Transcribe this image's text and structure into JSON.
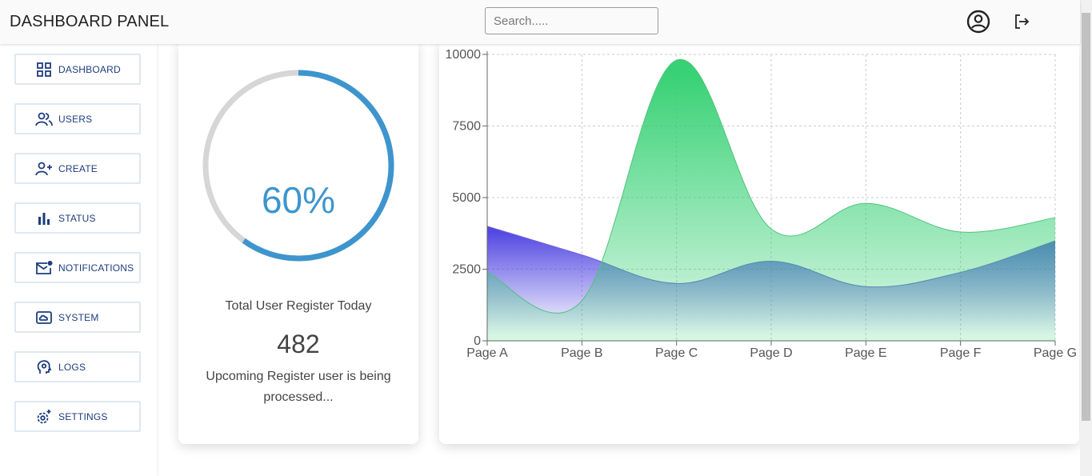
{
  "header": {
    "brand": "DASHBOARD PANEL",
    "search_placeholder": "Search.....",
    "profile_icon": "user-circle-icon",
    "logout_icon": "logout-icon"
  },
  "sidebar": {
    "items": [
      {
        "label": "DASHBOARD",
        "icon": "grid-icon"
      },
      {
        "label": "USERS",
        "icon": "users-icon"
      },
      {
        "label": "CREATE",
        "icon": "user-add-icon"
      },
      {
        "label": "STATUS",
        "icon": "bar-chart-icon"
      },
      {
        "label": "NOTIFICATIONS",
        "icon": "mail-badge-icon"
      },
      {
        "label": "SYSTEM",
        "icon": "cloud-box-icon"
      },
      {
        "label": "LOGS",
        "icon": "brain-icon"
      },
      {
        "label": "SETTINGS",
        "icon": "gear-icon"
      }
    ]
  },
  "progress_card": {
    "percent_text": "60%",
    "progress": 0.6,
    "title": "Total User Register Today",
    "count": "482",
    "note": "Upcoming Register user is being processed..."
  },
  "colors": {
    "accent": "#3e95cd",
    "sidebar_text": "#1d3d7e",
    "series_green": "#3ddc84",
    "series_blue": "#5b4fe0"
  },
  "chart_data": {
    "type": "area",
    "categories": [
      "Page A",
      "Page B",
      "Page C",
      "Page D",
      "Page E",
      "Page F",
      "Page G"
    ],
    "series": [
      {
        "values": [
          4000,
          3000,
          2000,
          2780,
          1890,
          2390,
          3490
        ]
      },
      {
        "values": [
          2400,
          1398,
          9800,
          3908,
          4800,
          3800,
          4300
        ]
      }
    ],
    "yticks": [
      0,
      2500,
      5000,
      7500,
      10000
    ],
    "ylim": [
      0,
      10000
    ],
    "grid": true
  }
}
